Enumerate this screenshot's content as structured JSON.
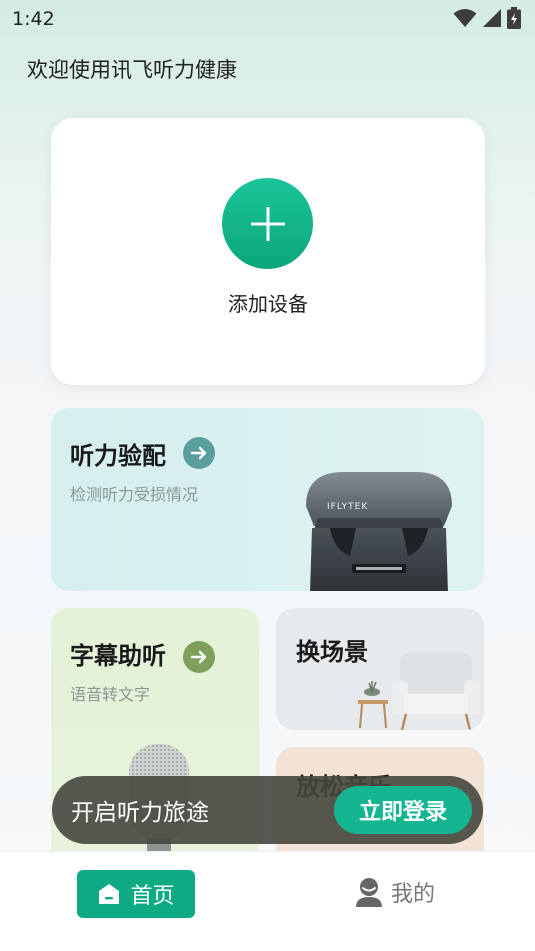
{
  "status_bar": {
    "time": "1:42",
    "icons": [
      "wifi-icon",
      "cellular-signal-icon",
      "battery-icon"
    ]
  },
  "greeting": "欢迎使用讯飞听力健康",
  "add_device": {
    "label": "添加设备",
    "icon": "plus-icon",
    "color": "#13b68c"
  },
  "cards": {
    "hearing_test": {
      "title": "听力验配",
      "subtitle": "检测听力受损情况",
      "brand_text": "IFLYTEK",
      "arrow_color": "#5b9ea0"
    },
    "subtitles": {
      "title": "字幕助听",
      "subtitle": "语音转文字",
      "arrow_color": "#7fa05d"
    },
    "scene": {
      "title": "换场景"
    },
    "music": {
      "title": "放松音乐"
    }
  },
  "login_banner": {
    "text": "开启听力旅途",
    "button": "立即登录"
  },
  "bottom_nav": {
    "home": "首页",
    "mine": "我的",
    "active": "home",
    "accent": "#0daa83"
  }
}
